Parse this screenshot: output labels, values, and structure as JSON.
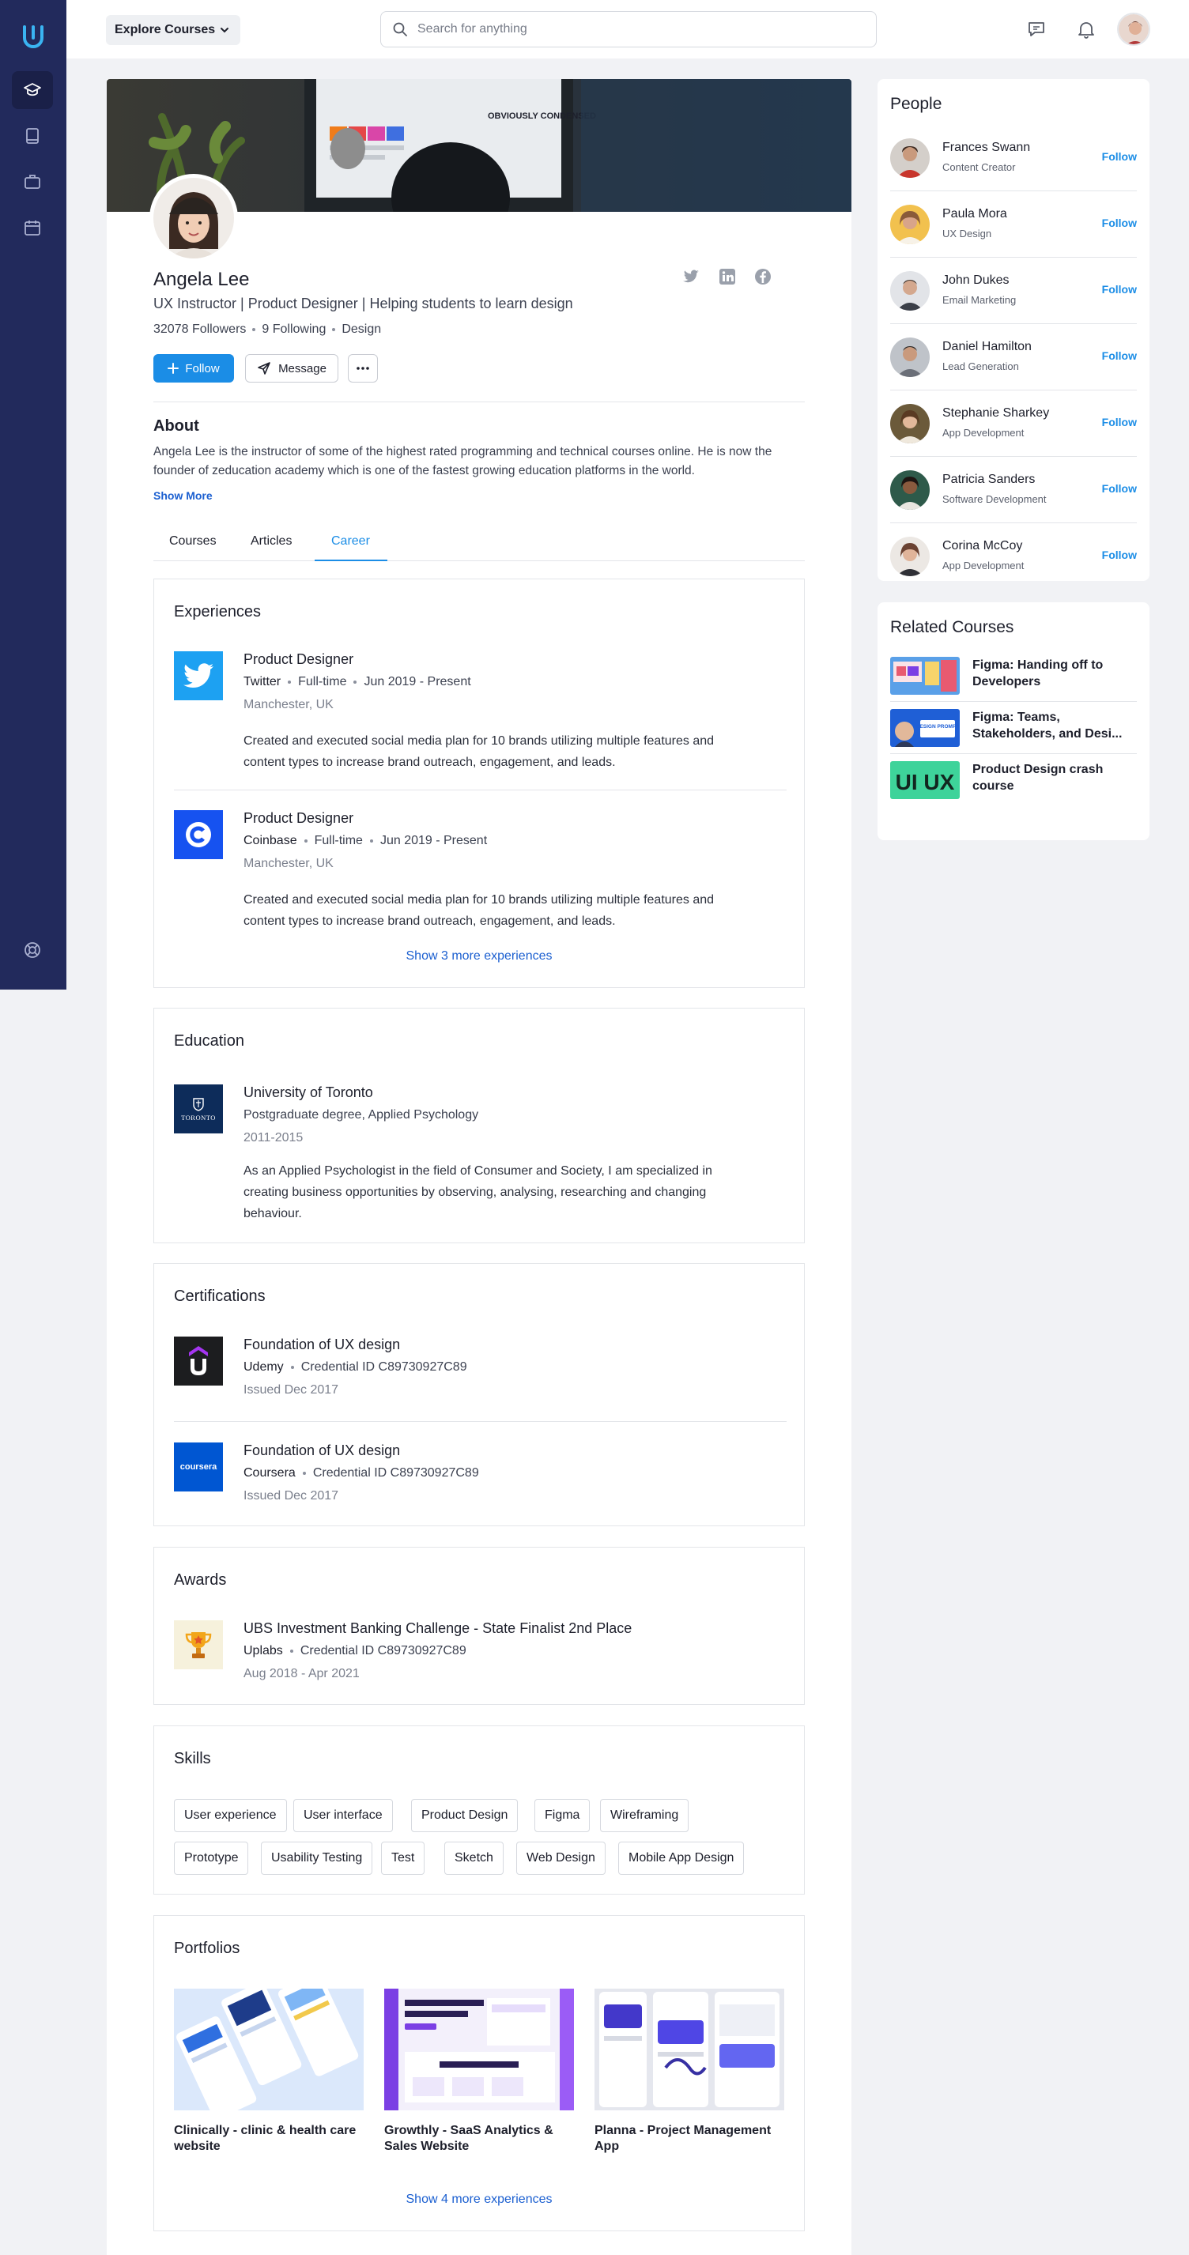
{
  "nav": {
    "explore_label": "Explore Courses",
    "search_placeholder": "Search for anything"
  },
  "profile": {
    "name": "Angela Lee",
    "headline": "UX Instructor | Product Designer | Helping students to learn design",
    "followers": "32078 Followers",
    "following": "9 Following",
    "category": "Design",
    "follow_label": "Follow",
    "message_label": "Message",
    "banner_text": "OBVIOUSLY CONDENSED"
  },
  "about": {
    "title": "About",
    "text": "Angela Lee is the instructor of some of the highest rated programming and technical courses online. He is now the founder of zeducation academy which is one of the fastest growing education platforms in the world.",
    "show_more": "Show More"
  },
  "tabs": [
    "Courses",
    "Articles",
    "Career"
  ],
  "active_tab": "Career",
  "experiences": {
    "title": "Experiences",
    "items": [
      {
        "title": "Product Designer",
        "company": "Twitter",
        "type": "Full-time",
        "period": "Jun 2019 - Present",
        "location": "Manchester, UK",
        "description": "Created and executed social media plan for 10 brands utilizing multiple features and content types to increase brand outreach, engagement, and leads."
      },
      {
        "title": "Product Designer",
        "company": "Coinbase",
        "type": "Full-time",
        "period": "Jun 2019 - Present",
        "location": "Manchester, UK",
        "description": "Created and executed social media plan for 10 brands utilizing multiple features and content types to increase brand outreach, engagement, and leads."
      }
    ],
    "more_link": "Show 3 more experiences"
  },
  "education": {
    "title": "Education",
    "school": "University of Toronto",
    "degree": "Postgraduate degree, Applied Psychology",
    "years": "2011-2015",
    "description": "As an Applied Psychologist in the field of Consumer and Society, I am specialized in creating business opportunities by observing, analysing, researching and changing behaviour.",
    "logo_text": "TORONTO"
  },
  "certifications": {
    "title": "Certifications",
    "items": [
      {
        "name": "Foundation of UX design",
        "issuer": "Udemy",
        "credential": "Credential ID C89730927C89",
        "issued": "Issued Dec 2017"
      },
      {
        "name": "Foundation of UX design",
        "issuer": "Coursera",
        "credential": "Credential ID C89730927C89",
        "issued": "Issued Dec 2017",
        "logo_text": "coursera"
      }
    ]
  },
  "awards": {
    "title": "Awards",
    "name": "UBS Investment Banking Challenge - State Finalist 2nd Place",
    "issuer": "Uplabs",
    "credential": "Credential ID C89730927C89",
    "period": "Aug 2018 - Apr 2021"
  },
  "skills": {
    "title": "Skills",
    "items": [
      "User experience",
      "User interface",
      "Product Design",
      "Figma",
      "Wireframing",
      "Prototype",
      "Usability Testing",
      "Test",
      "Sketch",
      "Web Design",
      "Mobile App Design"
    ]
  },
  "portfolios": {
    "title": "Portfolios",
    "items": [
      {
        "name": "Clinically - clinic & health care website"
      },
      {
        "name": "Growthly - SaaS Analytics & Sales Website"
      },
      {
        "name": "Planna - Project Management App"
      }
    ],
    "more_link": "Show 4 more experiences"
  },
  "people": {
    "title": "People",
    "follow_label": "Follow",
    "items": [
      {
        "name": "Frances Swann",
        "role": "Content Creator"
      },
      {
        "name": "Paula Mora",
        "role": "UX Design"
      },
      {
        "name": "John Dukes",
        "role": "Email Marketing"
      },
      {
        "name": "Daniel Hamilton",
        "role": "Lead Generation"
      },
      {
        "name": "Stephanie Sharkey",
        "role": "App Development"
      },
      {
        "name": "Patricia Sanders",
        "role": "Software Development"
      },
      {
        "name": "Corina McCoy",
        "role": "App Development"
      }
    ]
  },
  "related": {
    "title": "Related Courses",
    "items": [
      {
        "name": "Figma: Handing off to Developers"
      },
      {
        "name": "Figma: Teams, Stakeholders, and Desi..."
      },
      {
        "name": "Product Design crash course"
      }
    ],
    "thumb_text_2": "DESIGN PROMPT",
    "thumb_text_3": "UI UX"
  },
  "colors": {
    "sidebar": "#222a5c",
    "accent": "#1b8de6",
    "link": "#1b5fd0"
  }
}
